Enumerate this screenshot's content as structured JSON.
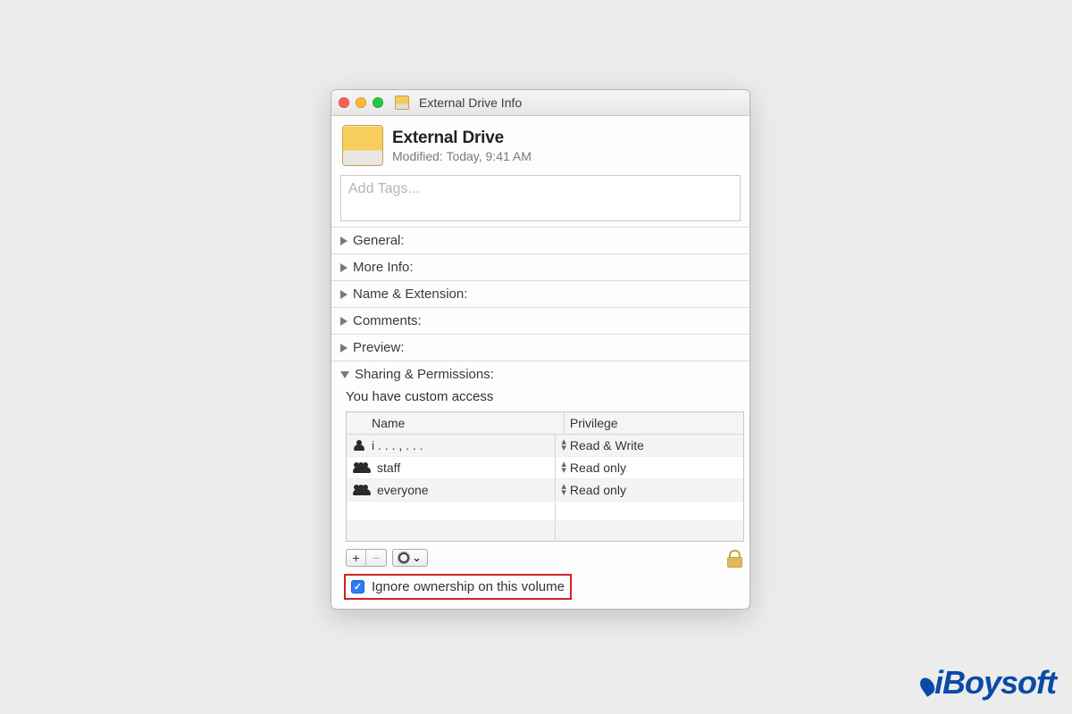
{
  "titlebar": {
    "title": "External Drive Info"
  },
  "header": {
    "name": "External Drive",
    "modified_label": "Modified:",
    "modified_value": "Today, 9:41 AM"
  },
  "tags": {
    "placeholder": "Add Tags..."
  },
  "sections": {
    "general": "General:",
    "more_info": "More Info:",
    "name_ext": "Name & Extension:",
    "comments": "Comments:",
    "preview": "Preview:",
    "sharing": "Sharing & Permissions:"
  },
  "sharing": {
    "access_note": "You have custom access",
    "columns": {
      "name": "Name",
      "privilege": "Privilege"
    },
    "rows": [
      {
        "icon": "user",
        "name": "i . . . , . . .",
        "privilege": "Read & Write"
      },
      {
        "icon": "group",
        "name": "staff",
        "privilege": "Read only"
      },
      {
        "icon": "group",
        "name": "everyone",
        "privilege": "Read only"
      }
    ],
    "add_label": "+",
    "remove_label": "−",
    "gear_label": "⌄"
  },
  "ignore": {
    "checked": true,
    "label": "Ignore ownership on this volume"
  },
  "watermark": "iBoysoft"
}
